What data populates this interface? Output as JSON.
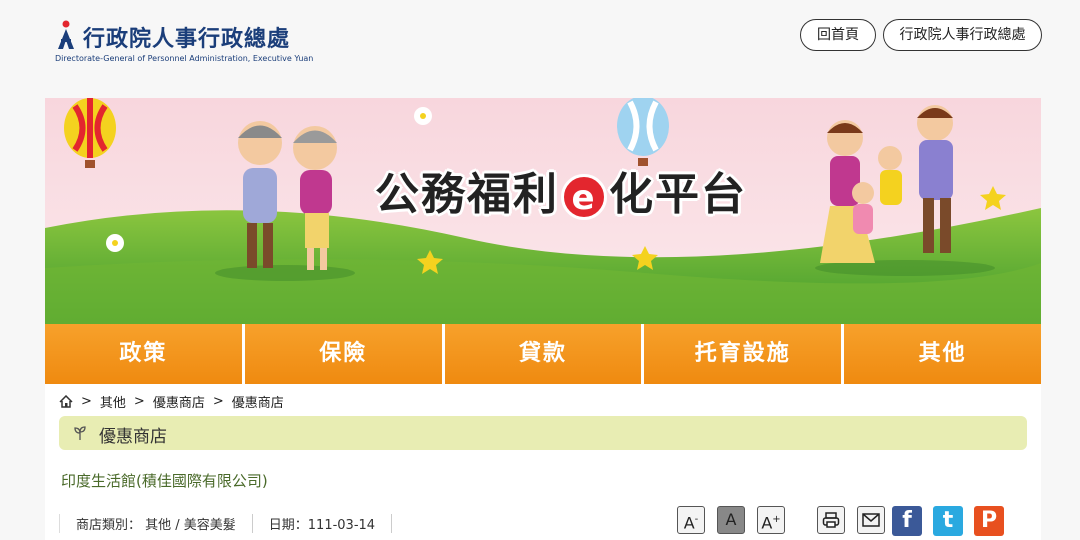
{
  "header": {
    "org_name": "行政院人事行政總處",
    "org_name_en": "Directorate-General of Personnel Administration, Executive Yuan",
    "home_button": "回首頁",
    "org_button": "行政院人事行政總處"
  },
  "banner": {
    "title_pre": "公務福利",
    "title_e": "e",
    "title_post": "化平台"
  },
  "nav": {
    "items": [
      "政策",
      "保險",
      "貸款",
      "托育設施",
      "其他"
    ]
  },
  "breadcrumb": {
    "items": [
      "其他",
      "優惠商店",
      "優惠商店"
    ],
    "separator": ">"
  },
  "section": {
    "title": "優惠商店"
  },
  "store": {
    "name": "印度生活館(積佳國際有限公司)",
    "category": "商店類別： 其他 / 美容美髮",
    "date": "日期：111-03-14"
  },
  "tools": {
    "font_small": "A",
    "font_medium": "A",
    "font_large": "A",
    "minus": "-",
    "plus": "+",
    "facebook": "f",
    "twitter": "t",
    "plurk": "P"
  },
  "colors": {
    "accent_orange": "#ef8a10",
    "brand_blue": "#1b3e7a",
    "section_green": "#e8edb3",
    "facebook": "#3b5998",
    "twitter": "#2aa9e0",
    "plurk": "#e8501f"
  }
}
